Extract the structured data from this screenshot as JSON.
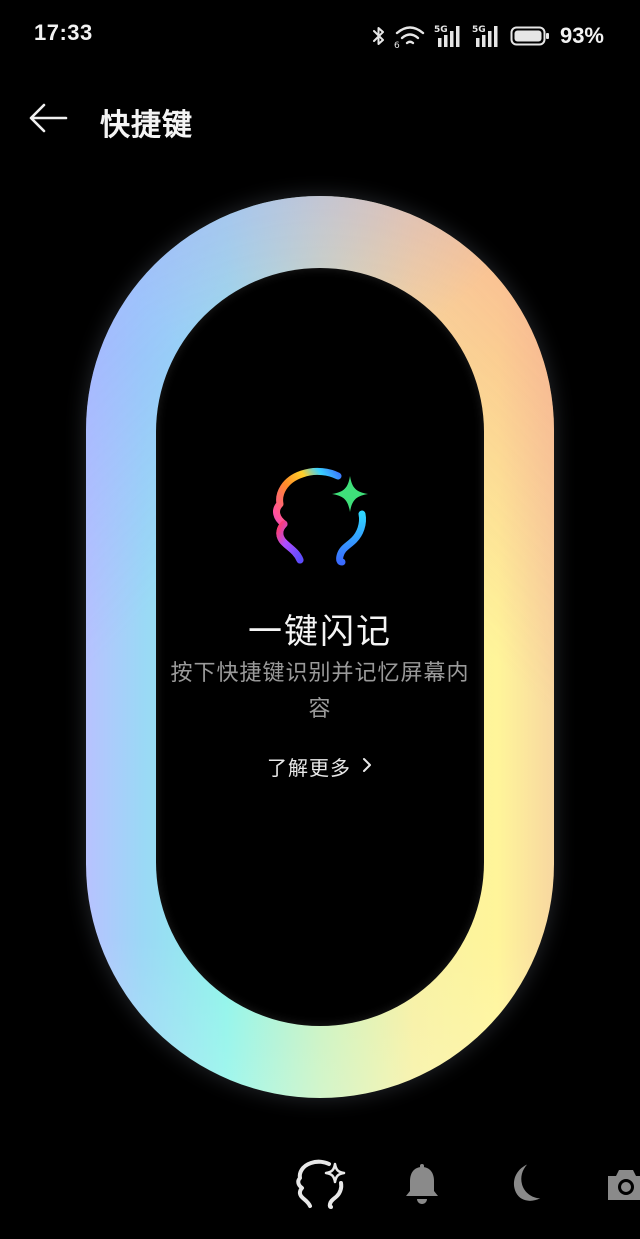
{
  "status_bar": {
    "time": "17:33",
    "network_1": "5G",
    "network_2": "5G",
    "battery_percent": "93%",
    "icons": [
      "bluetooth-icon",
      "wifi-icon",
      "signal-5g-icon",
      "signal-5g-icon",
      "battery-icon"
    ]
  },
  "header": {
    "back_icon": "arrow-left-icon",
    "title": "快捷键"
  },
  "feature": {
    "logo_icon": "memory-head-sparkle-icon",
    "title": "一键闪记",
    "description": "按下快捷键识别并记忆屏幕内容",
    "learn_more": "了解更多",
    "learn_more_icon": "chevron-right-icon"
  },
  "shortcuts": [
    {
      "name": "flash-memory",
      "icon": "memory-head-sparkle-icon",
      "selected": true
    },
    {
      "name": "ring-mode",
      "icon": "bell-icon",
      "selected": false
    },
    {
      "name": "do-not-disturb",
      "icon": "moon-icon",
      "selected": false
    },
    {
      "name": "camera",
      "icon": "camera-icon",
      "selected": false
    }
  ],
  "colors": {
    "background": "#000000",
    "text_primary": "#f5f5f5",
    "text_secondary": "#9a9a9a",
    "icon_inactive": "#8a8a8a"
  }
}
